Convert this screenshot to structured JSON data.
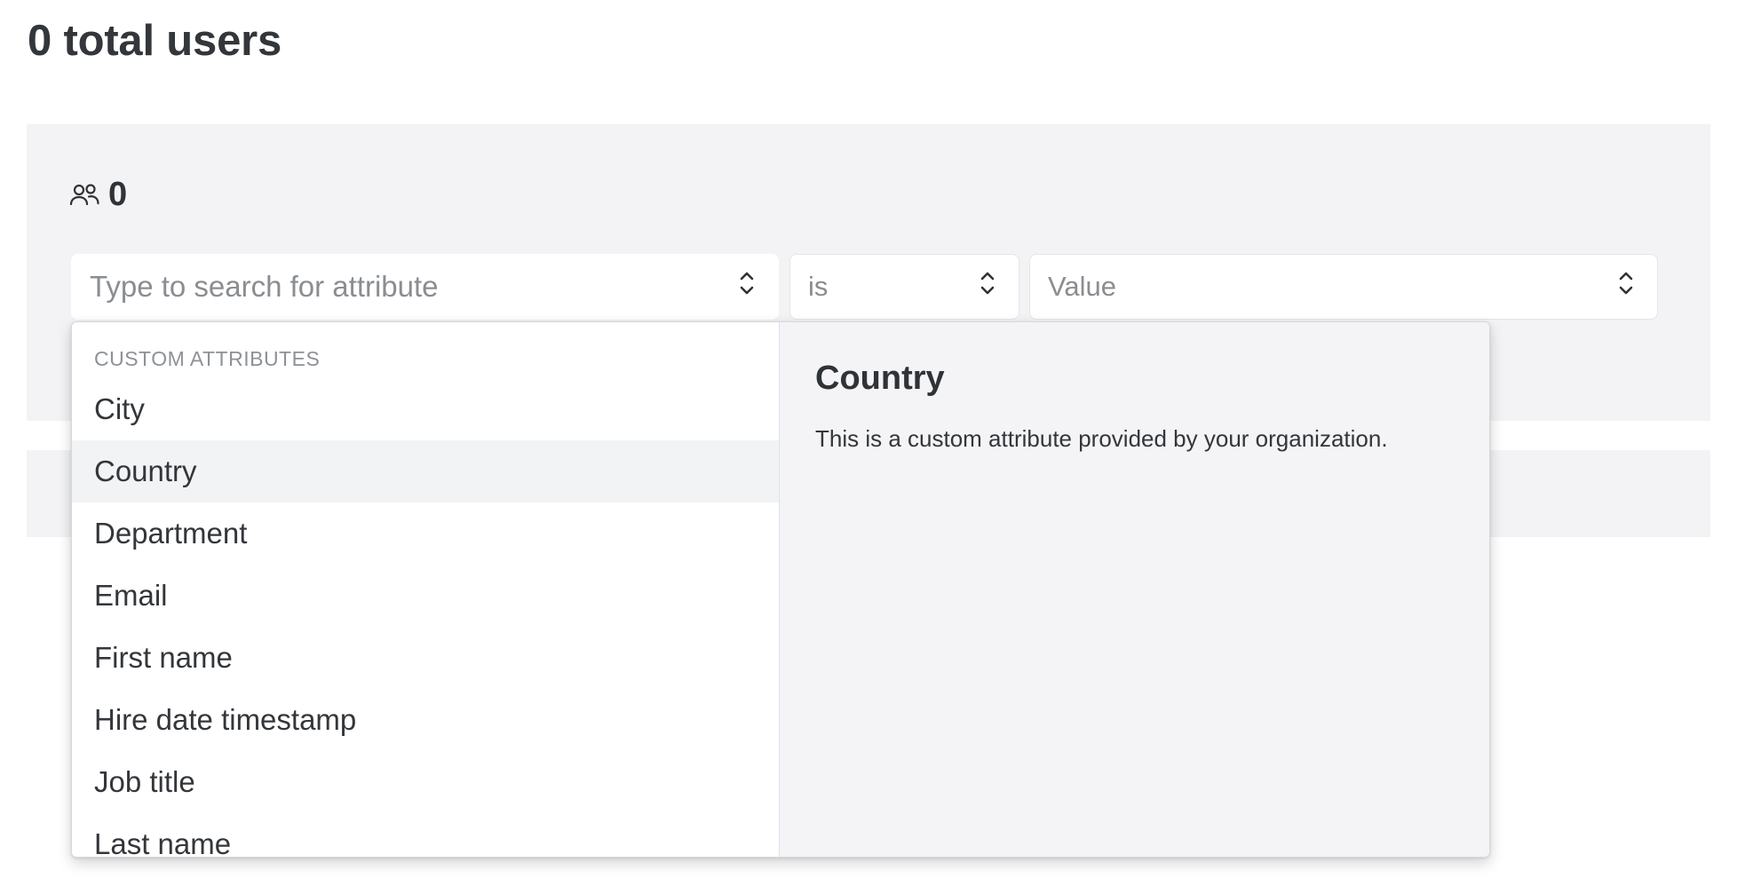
{
  "page": {
    "title": "0 total users"
  },
  "filter": {
    "user_count": "0",
    "attribute_placeholder": "Type to search for attribute",
    "operator_value": "is",
    "value_placeholder": "Value"
  },
  "dropdown": {
    "group_label": "CUSTOM ATTRIBUTES",
    "items": [
      {
        "label": "City"
      },
      {
        "label": "Country",
        "selected": true
      },
      {
        "label": "Department"
      },
      {
        "label": "Email"
      },
      {
        "label": "First name"
      },
      {
        "label": "Hire date timestamp"
      },
      {
        "label": "Job title"
      },
      {
        "label": "Last name"
      }
    ],
    "detail": {
      "title": "Country",
      "description": "This is a custom attribute provided by your organization."
    }
  },
  "icons": {
    "users": "users-icon",
    "chevron": "chevron-up-down-icon"
  },
  "colors": {
    "panel_bg": "#f3f3f5",
    "text": "#2f3236",
    "placeholder": "#8a8d91",
    "selected_row": "#f2f3f5"
  }
}
